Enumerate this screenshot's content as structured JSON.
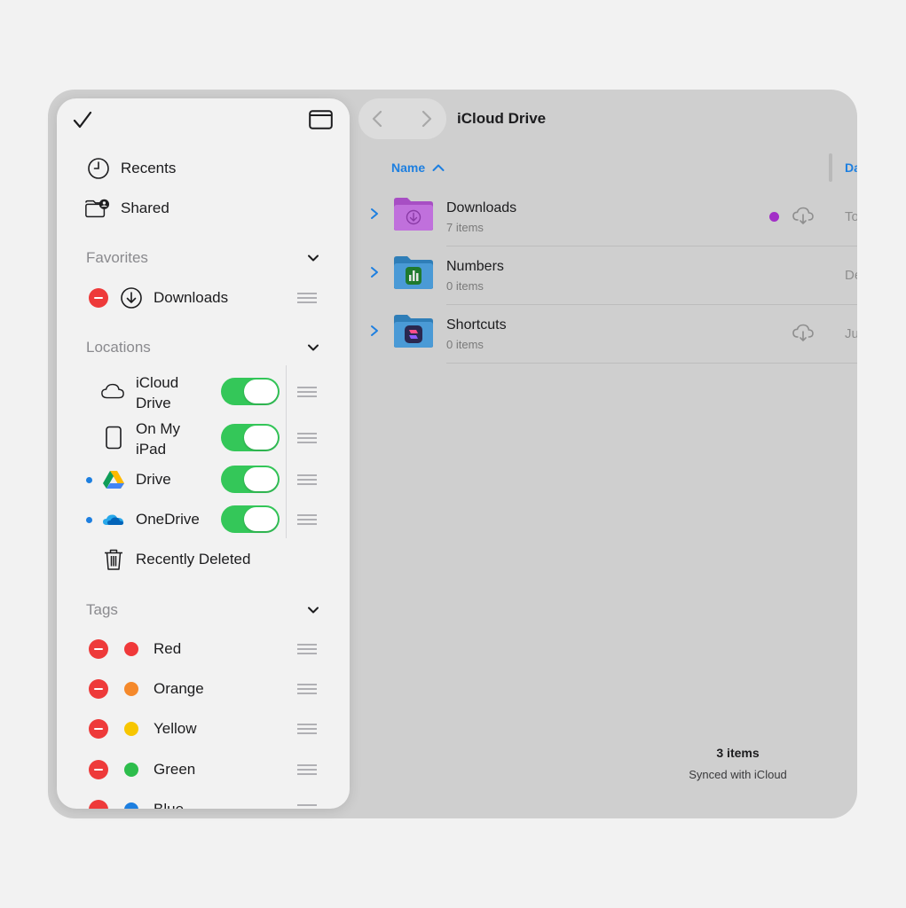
{
  "main": {
    "title": "iCloud Drive",
    "column_name": "Name",
    "column_date_partial": "Da",
    "files": [
      {
        "name": "Downloads",
        "sub": "7 items",
        "date_partial": "To",
        "tag_color": "#a22fc7",
        "folder_color": "#b85fd1",
        "icon": "download-folder-icon",
        "cloud": true
      },
      {
        "name": "Numbers",
        "sub": "0 items",
        "date_partial": "De",
        "folder_color": "#3b8fd0",
        "icon": "numbers-folder-icon",
        "cloud": false
      },
      {
        "name": "Shortcuts",
        "sub": "0 items",
        "date_partial": "Ju",
        "folder_color": "#3b8fd0",
        "icon": "shortcuts-folder-icon",
        "cloud": true
      }
    ],
    "footer": {
      "count": "3 items",
      "sync": "Synced with iCloud"
    }
  },
  "sidebar": {
    "recents": "Recents",
    "shared": "Shared",
    "favorites_header": "Favorites",
    "favorites": [
      {
        "label": "Downloads"
      }
    ],
    "locations_header": "Locations",
    "locations": [
      {
        "label": "iCloud Drive",
        "enabled": true
      },
      {
        "label": "On My iPad",
        "enabled": true
      },
      {
        "label": "Drive",
        "enabled": true
      },
      {
        "label": "OneDrive",
        "enabled": true
      },
      {
        "label": "Recently Deleted"
      }
    ],
    "tags_header": "Tags",
    "tags": [
      {
        "label": "Red",
        "color": "#f0393a"
      },
      {
        "label": "Orange",
        "color": "#f5892b"
      },
      {
        "label": "Yellow",
        "color": "#f7c600"
      },
      {
        "label": "Green",
        "color": "#2dbd4c"
      },
      {
        "label": "Blue",
        "color": "#1d7fe0"
      }
    ]
  },
  "colors": {
    "accent": "#1d7fe0",
    "toggle_on": "#34c759",
    "delete_red": "#ee3a3a"
  }
}
